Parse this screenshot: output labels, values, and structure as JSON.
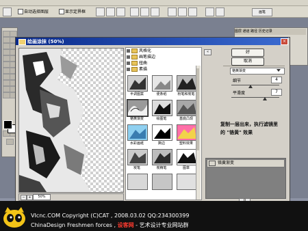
{
  "options_bar": {
    "auto_select_layer": "自动选择图层",
    "show_transform_controls": "显示定界框",
    "brush_tab": "画笔"
  },
  "right_palette": {
    "tabs": "图层 通道 路径 历史记录"
  },
  "gallery": {
    "title": "绘画涂抹 (50%)",
    "close": "×",
    "zoom_minus": "−",
    "zoom_plus": "+",
    "zoom_value": "50%",
    "folders": [
      {
        "label": "风格化",
        "state": "collapsed"
      },
      {
        "label": "画笔描边",
        "state": "collapsed"
      },
      {
        "label": "扭曲",
        "state": "collapsed"
      },
      {
        "label": "素描",
        "state": "expanded"
      }
    ],
    "filters": [
      {
        "label": "半调图案",
        "selected": false
      },
      {
        "label": "便条纸",
        "selected": false
      },
      {
        "label": "粉笔和炭笔",
        "selected": false
      },
      {
        "label": "铬黄渐变",
        "selected": true
      },
      {
        "label": "绘图笔",
        "selected": false
      },
      {
        "label": "基底凸现",
        "selected": false
      },
      {
        "label": "水彩画纸",
        "selected": false
      },
      {
        "label": "撕边",
        "selected": false
      },
      {
        "label": "塑料效果",
        "selected": false
      },
      {
        "label": "炭笔",
        "selected": false
      },
      {
        "label": "炭精笔",
        "selected": false
      },
      {
        "label": "图章",
        "selected": false
      }
    ],
    "collapse_button": "«",
    "ok": "好",
    "cancel": "取消",
    "selected_filter": "铬黄渐变",
    "params": [
      {
        "label": "细节",
        "value": "4",
        "fraction": 0.4
      },
      {
        "label": "平滑度",
        "value": "7",
        "fraction": 0.7
      }
    ],
    "note": "复制一层出来，执行滤镜里的 \"铬黄\" 效果",
    "effect_layer": "铬黄渐变"
  },
  "banner": {
    "line1": "VIcnc.COM  Copyright (C)CAT , 2008.03.02  QQ:234300399",
    "line2_prefix": "ChinaDesign Freshmen forces , ",
    "line2_red": "设客网",
    "line2_suffix": " - 艺术设计专业网站群"
  },
  "colors": {
    "titlebar": "#0a2a8a",
    "dialog": "#d4d0c8",
    "banner": "#111111",
    "accent_red": "#ff3b2f"
  }
}
